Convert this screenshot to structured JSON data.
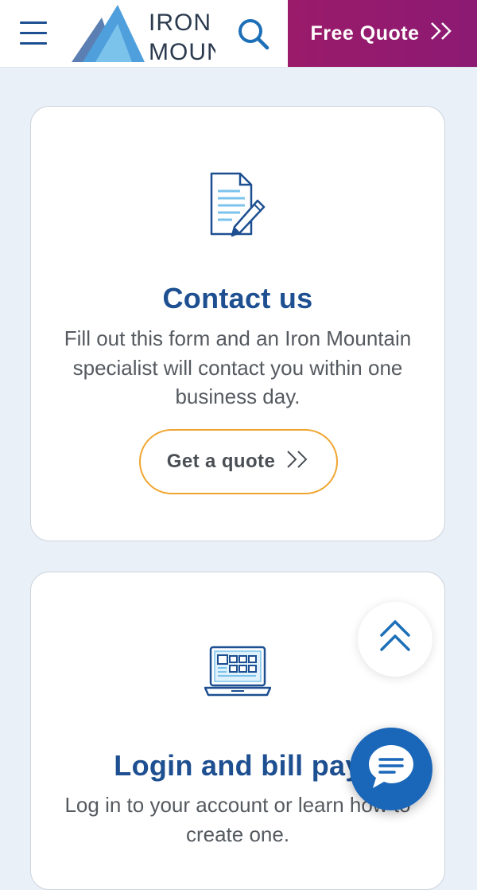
{
  "header": {
    "logo_line1": "IRON",
    "logo_line2": "MOUNTAIN",
    "quote_label": "Free Quote",
    "quote_chevron": "❯❯"
  },
  "cards": [
    {
      "icon": "document-pencil-icon",
      "title": "Contact us",
      "text": "Fill out this form and an Iron Mountain specialist will contact you within one business day.",
      "button_label": "Get a quote",
      "button_chevron": "❯❯"
    },
    {
      "icon": "laptop-icon",
      "title": "Login and bill pay",
      "text": "Log in to your account or learn how to create one."
    }
  ],
  "colors": {
    "brand_blue": "#1d4f91",
    "quote_magenta": "#8c1a73",
    "button_orange": "#f0a530",
    "chat_blue": "#1a66b8",
    "page_bg": "#eaf0f8"
  },
  "icons": {
    "menu": "hamburger-menu-icon",
    "search": "search-icon",
    "scroll_top": "chevron-double-up-icon",
    "chat": "chat-bubble-icon"
  }
}
